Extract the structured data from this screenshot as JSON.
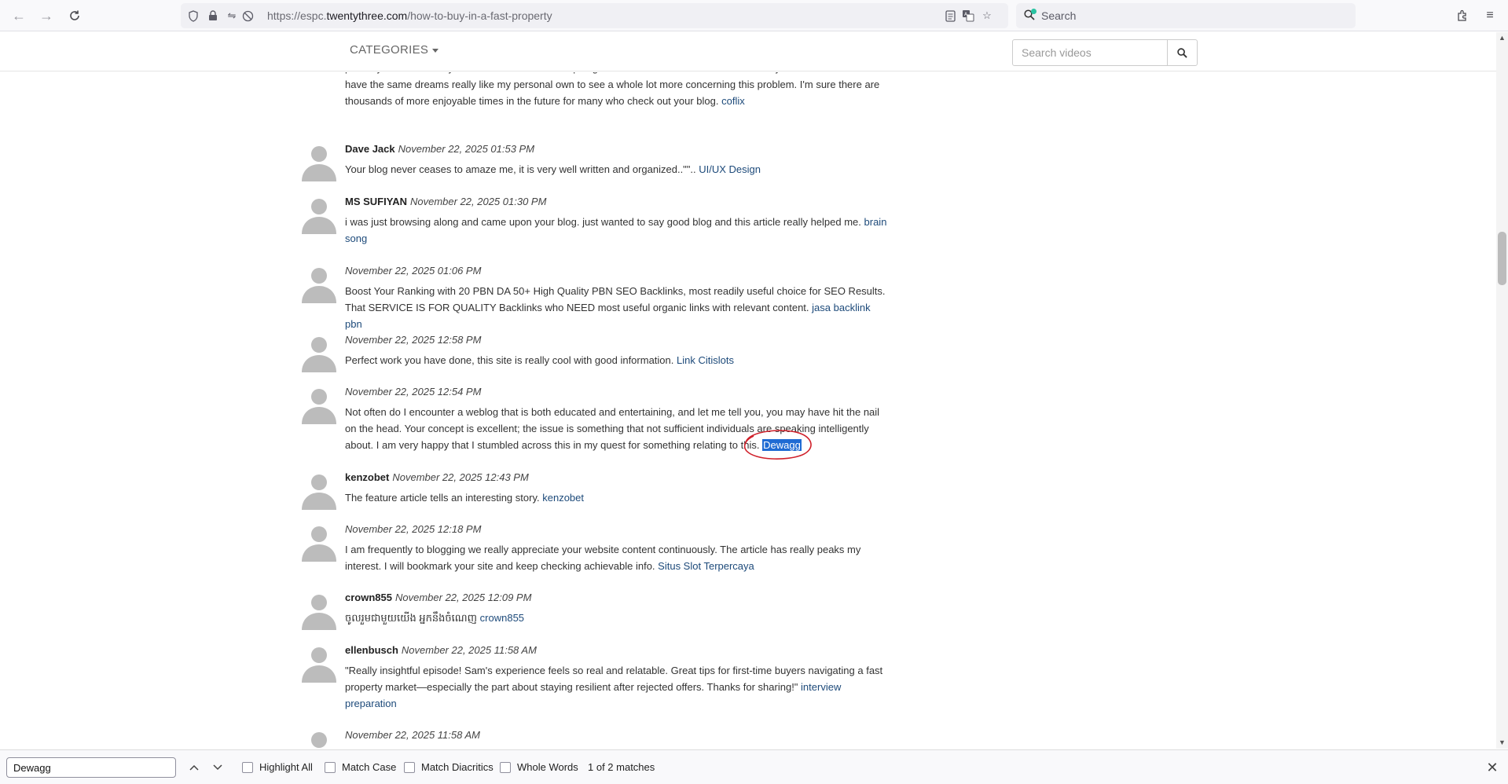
{
  "browser": {
    "url_prefix": "https://espc.",
    "url_domain": "twentythree.com",
    "url_path": "/how-to-buy-in-a-fast-property",
    "search_label": "Search"
  },
  "header": {
    "categories_label": "CATEGORIES",
    "video_search_placeholder": "Search videos"
  },
  "top_fragment": {
    "lines": "possibly have tried it if you ever wanted. These inspiring ideas likewise acted like a fantastic way to know that the rest have the same dreams really like my personal own to see a whole lot more concerning this problem. I'm sure there are thousands of more enjoyable times in the future for many who check out your blog.",
    "link": "coflix"
  },
  "comments": [
    {
      "author": "Dave Jack",
      "date": "November 22, 2025 01:53 PM",
      "text": "Your blog never ceases to amaze me, it is very well written and organized..\"\"..",
      "link": "UI/UX Design"
    },
    {
      "author": "MS SUFIYAN",
      "date": "November 22, 2025 01:30 PM",
      "text": "i was just browsing along and came upon your blog. just wanted to say good blog and this article really helped me.",
      "link": "brain song"
    },
    {
      "author": "",
      "date": "November 22, 2025 01:06 PM",
      "text": "Boost Your Ranking with 20 PBN DA 50+ High Quality PBN SEO Backlinks, most readily useful choice for SEO Results. That SERVICE IS FOR QUALITY Backlinks who NEED most useful organic links with relevant content.",
      "link": "jasa backlink pbn"
    },
    {
      "author": "",
      "date": "November 22, 2025 12:58 PM",
      "text": "Perfect work you have done, this site is really cool with good information.",
      "link": "Link Citislots"
    },
    {
      "author": "",
      "date": "November 22, 2025 12:54 PM",
      "text": "Not often do I encounter a weblog that is both educated and entertaining, and let me tell you, you may have hit the nail on the head. Your concept is excellent; the issue is something that not sufficient individuals are speaking intelligently about. I am very happy that I stumbled across this in my quest for something relating to this.",
      "link": "Dewagg"
    },
    {
      "author": "kenzobet",
      "date": "November 22, 2025 12:43 PM",
      "text": "The feature article tells an interesting story.",
      "link": "kenzobet"
    },
    {
      "author": "",
      "date": "November 22, 2025 12:18 PM",
      "text": "I am frequently to blogging we really appreciate your website content continuously. The article has really peaks my interest. I will bookmark your site and keep checking achievable info.",
      "link": "Situs Slot Terpercaya"
    },
    {
      "author": "crown855",
      "date": "November 22, 2025 12:09 PM",
      "text": "ចូលរួមជាមួយយើង អ្នកនឹងចំណេញ",
      "link": "crown855"
    },
    {
      "author": "ellenbusch",
      "date": "November 22, 2025 11:58 AM",
      "text": "\"Really insightful episode! Sam's experience feels so real and relatable. Great tips for first-time buyers navigating a fast property market—especially the part about staying resilient after rejected offers. Thanks for sharing!\"",
      "link": "interview preparation"
    },
    {
      "author": "",
      "date": "November 22, 2025 11:58 AM",
      "text": "",
      "link": ""
    }
  ],
  "findbar": {
    "query": "Dewagg",
    "highlight_all": "Highlight All",
    "match_case": "Match Case",
    "match_diacritics": "Match Diacritics",
    "whole_words": "Whole Words",
    "status": "1 of 2 matches"
  },
  "colors": {
    "link": "#1d4a7a",
    "selection": "#1f6bd3",
    "annotation": "#d0202a"
  }
}
